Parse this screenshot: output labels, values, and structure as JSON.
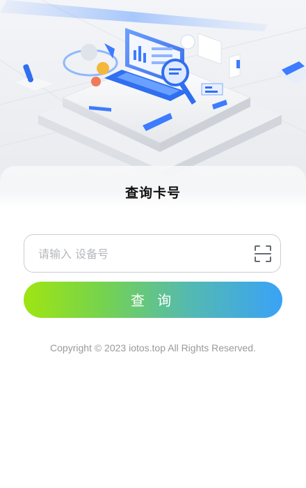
{
  "header": {
    "title": "查询卡号"
  },
  "form": {
    "device_input": {
      "value": "",
      "placeholder": "请输入 设备号"
    },
    "scan_icon": "scan-icon",
    "submit_label": "查 询"
  },
  "footer": {
    "copyright": "Copyright © 2023 iotos.top All Rights Reserved."
  },
  "colors": {
    "button_gradient_start": "#9fe512",
    "button_gradient_end": "#3aa2f7",
    "accent_blue": "#2f6ff0",
    "placeholder": "#b5b8bd",
    "copyright": "#999999"
  }
}
